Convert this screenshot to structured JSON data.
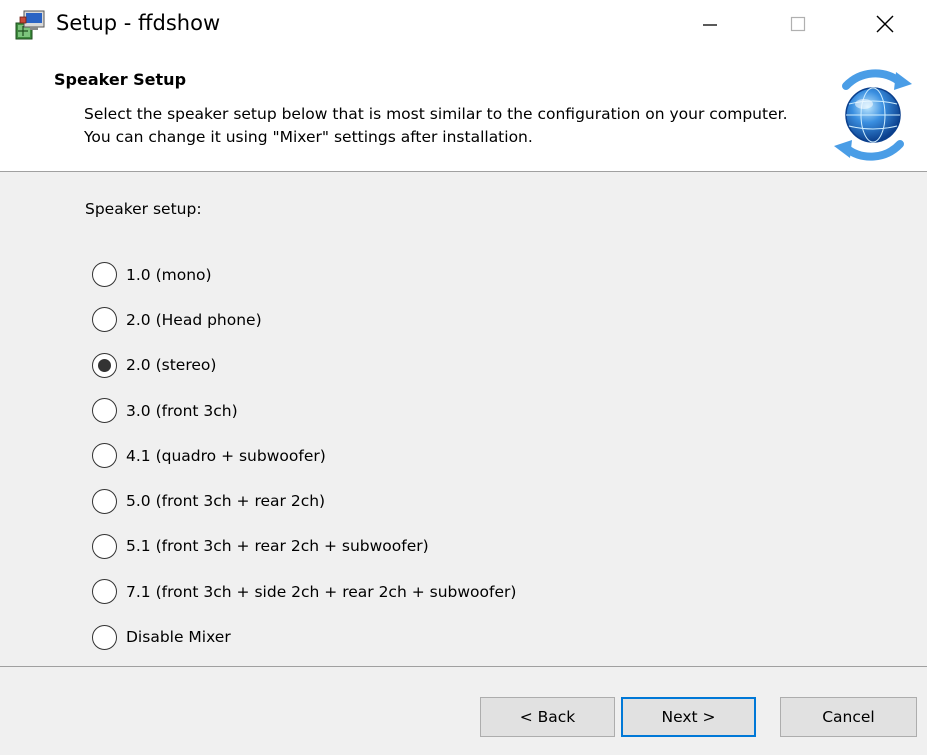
{
  "window": {
    "title": "Setup - ffdshow",
    "icon": "installer-icon",
    "controls": {
      "minimize_icon": "minimize-icon",
      "maximize_icon": "maximize-icon",
      "close_icon": "close-icon"
    }
  },
  "header": {
    "title": "Speaker Setup",
    "description": "Select the speaker setup below that is most similar to the configuration on your computer. You can change it using \"Mixer\" settings after installation.",
    "logo_icon": "globe-refresh-icon"
  },
  "body": {
    "group_label": "Speaker setup:",
    "options": [
      {
        "label": "1.0 (mono)",
        "selected": false
      },
      {
        "label": "2.0 (Head phone)",
        "selected": false
      },
      {
        "label": "2.0 (stereo)",
        "selected": true
      },
      {
        "label": "3.0 (front 3ch)",
        "selected": false
      },
      {
        "label": "4.1 (quadro + subwoofer)",
        "selected": false
      },
      {
        "label": "5.0 (front 3ch + rear 2ch)",
        "selected": false
      },
      {
        "label": "5.1 (front 3ch + rear 2ch + subwoofer)",
        "selected": false
      },
      {
        "label": "7.1 (front 3ch + side 2ch + rear 2ch + subwoofer)",
        "selected": false
      },
      {
        "label": "Disable Mixer",
        "selected": false
      }
    ]
  },
  "buttons": {
    "back": "< Back",
    "next": "Next >",
    "cancel": "Cancel"
  },
  "colors": {
    "body_bg": "#f0f0f0",
    "focus_border": "#0078d7",
    "button_bg": "#e1e1e1"
  }
}
